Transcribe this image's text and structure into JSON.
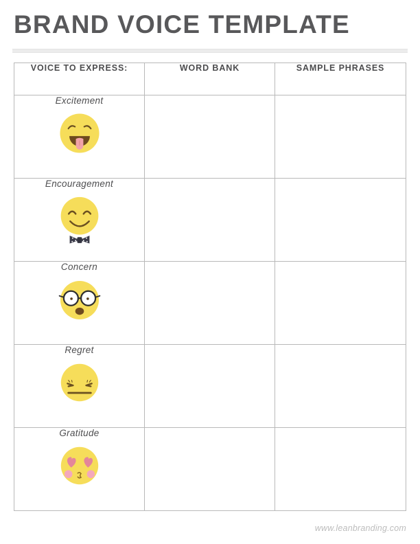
{
  "document": {
    "title": "BRAND VOICE TEMPLATE",
    "footer_url": "www.leanbranding.com"
  },
  "table": {
    "columns": [
      {
        "label": "VOICE TO EXPRESS:"
      },
      {
        "label": "WORD BANK"
      },
      {
        "label": "SAMPLE PHRASES"
      }
    ],
    "rows": [
      {
        "voice": "Excitement",
        "emoji": "face-tongue-out-icon",
        "word_bank": "",
        "sample_phrases": ""
      },
      {
        "voice": "Encouragement",
        "emoji": "face-smile-bowtie-icon",
        "word_bank": "",
        "sample_phrases": ""
      },
      {
        "voice": "Concern",
        "emoji": "face-glasses-worried-icon",
        "word_bank": "",
        "sample_phrases": ""
      },
      {
        "voice": "Regret",
        "emoji": "face-flat-mouth-icon",
        "word_bank": "",
        "sample_phrases": ""
      },
      {
        "voice": "Gratitude",
        "emoji": "face-heart-eyes-icon",
        "word_bank": "",
        "sample_phrases": ""
      }
    ]
  },
  "colors": {
    "title_text": "#58585a",
    "header_text": "#4c4c4e",
    "label_text": "#4d4d4f",
    "table_border": "#b9b9b9",
    "rule": "#ececec",
    "footer_text": "#bdbdbd",
    "emoji_yellow": "#f6dd5a",
    "emoji_yellow_shade": "#ebcf4b",
    "emoji_dark": "#6b5021",
    "mouth_brown": "#6e4a1e",
    "tongue_pink": "#f2a3a8",
    "bowtie_navy": "#3b3c4a",
    "heart_pink": "#e4869a",
    "blush_pink": "#f4a9bd"
  }
}
